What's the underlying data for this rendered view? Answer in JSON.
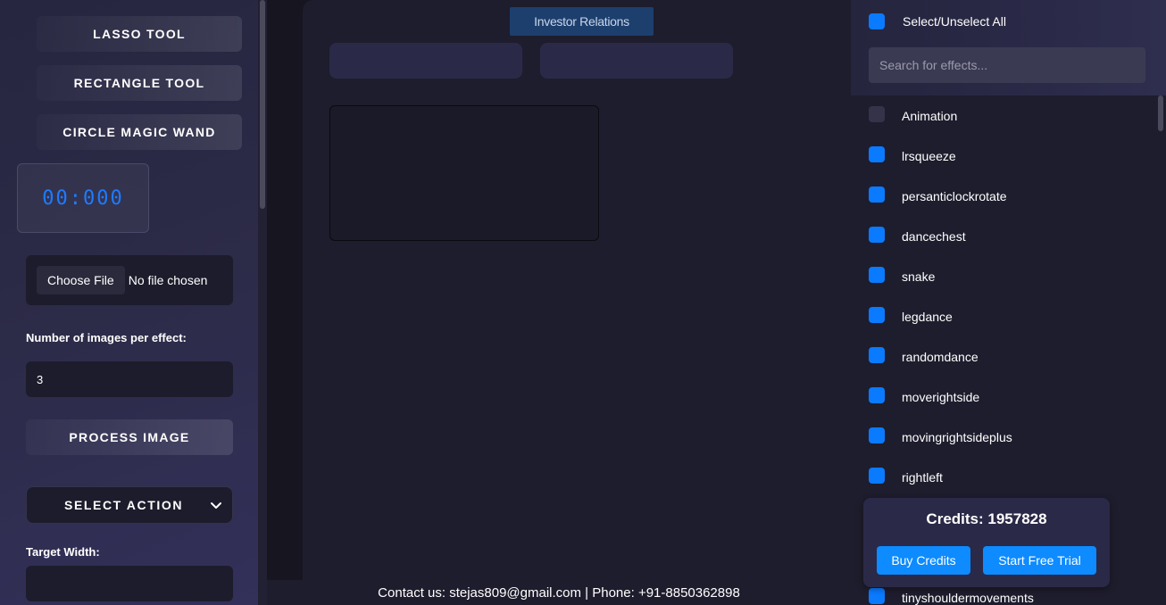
{
  "sidebar": {
    "tools": [
      "LASSO TOOL",
      "RECTANGLE TOOL",
      "CIRCLE MAGIC WAND"
    ],
    "timer": "00:000",
    "file": {
      "choose_label": "Choose File",
      "status": "No file chosen"
    },
    "images_label": "Number of images per effect:",
    "images_value": "3",
    "process_label": "PROCESS IMAGE",
    "select_action_label": "SELECT ACTION",
    "target_width_label": "Target Width:"
  },
  "main": {
    "investor_label": "Investor Relations",
    "footer": "Contact us: stejas809@gmail.com | Phone: +91-8850362898"
  },
  "effects": {
    "select_all_label": "Select/Unselect All",
    "search_placeholder": "Search for effects...",
    "items": [
      {
        "label": "Animation",
        "checked": false
      },
      {
        "label": "lrsqueeze",
        "checked": true
      },
      {
        "label": "persanticlockrotate",
        "checked": true
      },
      {
        "label": "dancechest",
        "checked": true
      },
      {
        "label": "snake",
        "checked": true
      },
      {
        "label": "legdance",
        "checked": true
      },
      {
        "label": "randomdance",
        "checked": true
      },
      {
        "label": "moverightside",
        "checked": true
      },
      {
        "label": "movingrightsideplus",
        "checked": true
      },
      {
        "label": "rightleft",
        "checked": true
      },
      {
        "label": "tinyshouldermovements",
        "checked": true
      }
    ]
  },
  "credits": {
    "title": "Credits: 1957828",
    "buy_label": "Buy Credits",
    "trial_label": "Start Free Trial"
  },
  "colors": {
    "accent": "#0a7aff",
    "button_blue": "#0d8bff",
    "timer": "#1e7bff"
  }
}
